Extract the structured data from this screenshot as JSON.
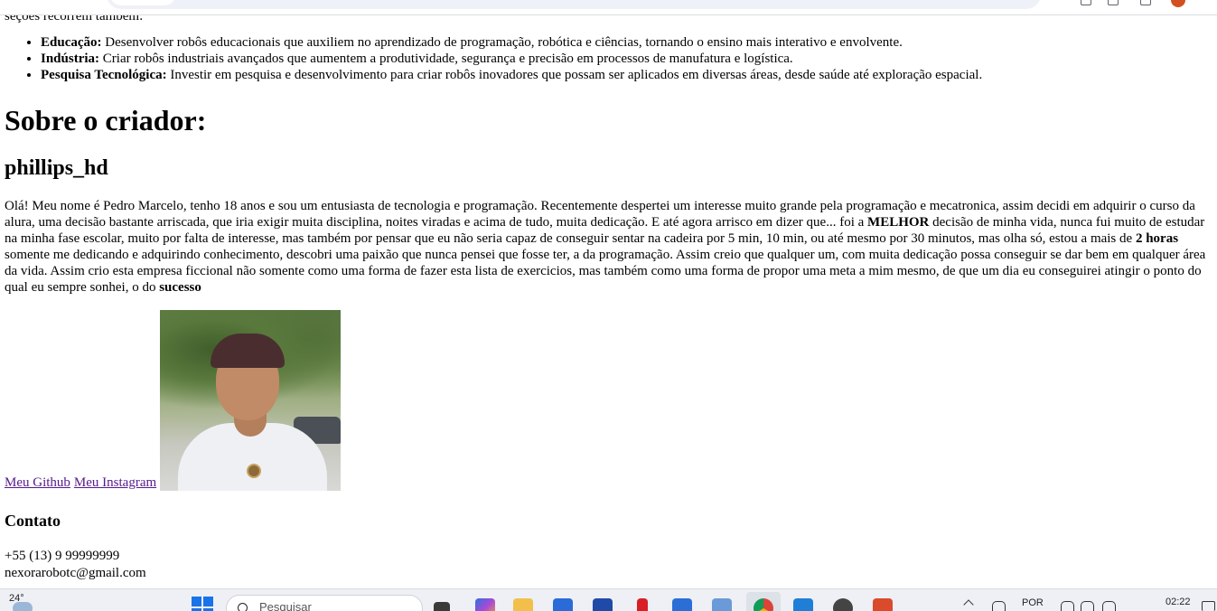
{
  "page": {
    "cut_text": "seções recorrem também:",
    "goals": [
      {
        "title": "Educação:",
        "text": " Desenvolver robôs educacionais que auxiliem no aprendizado de programação, robótica e ciências, tornando o ensino mais interativo e envolvente."
      },
      {
        "title": "Indústria:",
        "text": " Criar robôs industriais avançados que aumentem a produtividade, segurança e precisão em processos de manufatura e logística."
      },
      {
        "title": "Pesquisa Tecnológica:",
        "text": " Investir em pesquisa e desenvolvimento para criar robôs inovadores que possam ser aplicados em diversas áreas, desde saúde até exploração espacial."
      }
    ],
    "creator_heading": "Sobre o criador:",
    "creator_name": "phillips_hd",
    "bio": {
      "part1": "Olá! Meu nome é Pedro Marcelo, tenho 18 anos e sou um entusiasta de tecnologia e programação. Recentemente despertei um interesse muito grande pela programação e mecatronica, assim decidi em adquirir o curso da alura, uma decisão bastante arriscada, que iria exigir muita disciplina, noites viradas e acima de tudo, muita dedicação. E até agora arrisco em dizer que... foi a ",
      "bold1": "MELHOR",
      "part2": " decisão de minha vida, nunca fui muito de estudar na minha fase escolar, muito por falta de interesse, mas também por pensar que eu não seria capaz de conseguir sentar na cadeira por 5 min, 10 min, ou até mesmo por 30 minutos, mas olha só, estou a mais de ",
      "bold2": "2 horas",
      "part3": " somente me dedicando e adquirindo conhecimento, descobri uma paixão que nunca pensei que fosse ter, a da programação. Assim creio que qualquer um, com muita dedicação possa conseguir se dar bem em qualquer área da vida. Assim crio esta empresa ficcional não somente como uma forma de fazer esta lista de exercicios, mas também como uma forma de propor uma meta a mim mesmo, de que um dia eu conseguirei atingir o ponto do qual eu sempre sonhei, o do ",
      "bold3": "sucesso"
    },
    "links": {
      "github": "Meu Github",
      "instagram": "Meu Instagram"
    },
    "contact": {
      "heading": "Contato",
      "phone": "+55 (13) 9 99999999",
      "email": "nexorarobotc@gmail.com"
    }
  },
  "taskbar": {
    "temperature": "24°",
    "search_placeholder": "Pesquisar",
    "language": "POR",
    "time": "02:22"
  },
  "colors": {
    "link_visited": "#551a8b",
    "taskbar_bg": "#eef0f5",
    "windows_blue": "#1a73e8"
  }
}
